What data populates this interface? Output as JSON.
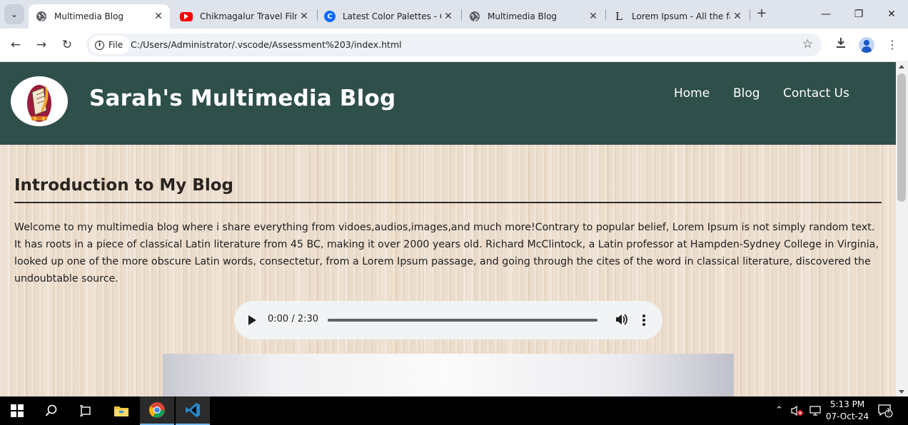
{
  "browser": {
    "tabs": [
      {
        "title": "Multimedia Blog",
        "active": true,
        "favicon": "globe-icon"
      },
      {
        "title": "Chikmagalur Travel Film |",
        "active": false,
        "favicon": "youtube-icon"
      },
      {
        "title": "Latest Color Palettes - Co",
        "active": false,
        "favicon": "coolors-icon"
      },
      {
        "title": "Multimedia Blog",
        "active": false,
        "favicon": "globe-icon"
      },
      {
        "title": "Lorem Ipsum - All the fac",
        "active": false,
        "favicon": "lipsum-icon"
      }
    ],
    "new_tab": "+",
    "window_controls": {
      "minimize": "—",
      "restore": "❐",
      "close": "✕"
    },
    "address": {
      "chip_label": "File",
      "url": "C:/Users/Administrator/.vscode/Assessment%203/index.html"
    }
  },
  "site": {
    "title": "Sarah's Multimedia Blog",
    "nav": [
      "Home",
      "Blog",
      "Contact Us"
    ],
    "section": {
      "heading": "Introduction to My Blog",
      "body": "Welcome to my multimedia blog where i share everything from vidoes,audios,images,and much more!Contrary to popular belief, Lorem Ipsum is not simply random text. It has roots in a piece of classical Latin literature from 45 BC, making it over 2000 years old. Richard McClintock, a Latin professor at Hampden-Sydney College in Virginia, looked up one of the more obscure Latin words, consectetur, from a Lorem Ipsum passage, and going through the cites of the word in classical literature, discovered the undoubtable source."
    },
    "audio": {
      "time": "0:00 / 2:30",
      "progress": 0
    },
    "colors": {
      "header_bg": "#2f4f4a",
      "page_bg": "#ecdccb"
    }
  },
  "taskbar": {
    "time": "5:13 PM",
    "date": "07-Oct-24",
    "notification_count": "1",
    "apps": [
      "windows-start-icon",
      "search-icon",
      "task-view-icon",
      "file-explorer-icon",
      "chrome-icon",
      "vscode-icon"
    ]
  }
}
